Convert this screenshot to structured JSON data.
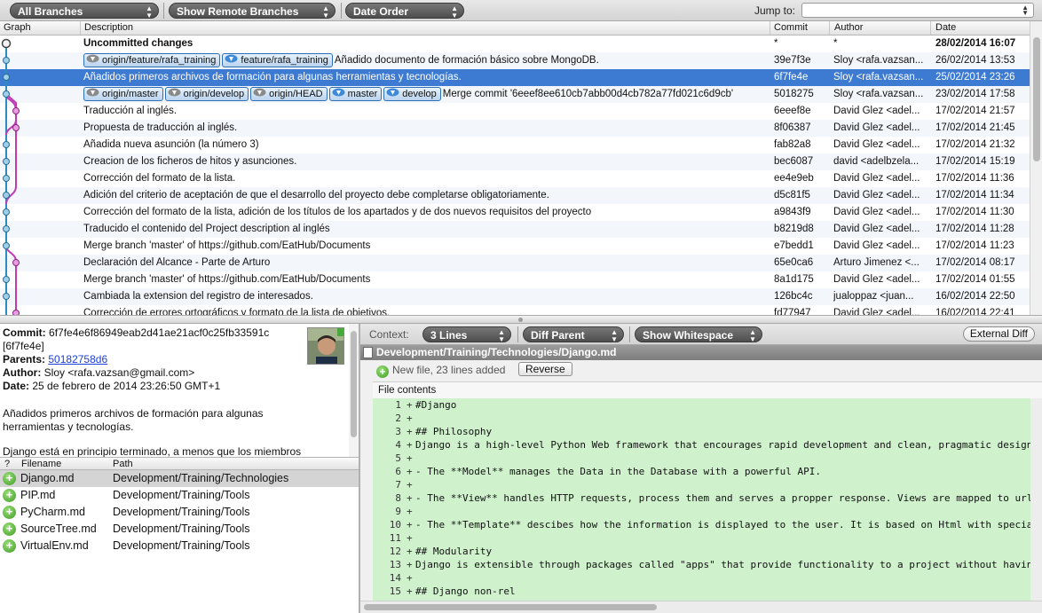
{
  "toolbar": {
    "branches_select": "All Branches",
    "remote_select": "Show Remote Branches",
    "order_select": "Date Order",
    "jump_label": "Jump to:"
  },
  "history": {
    "columns": {
      "graph": "Graph",
      "description": "Description",
      "commit": "Commit",
      "author": "Author",
      "date": "Date"
    },
    "rows": [
      {
        "tags": [],
        "description": "Uncommitted changes",
        "commit": "*",
        "author": "*",
        "date": "28/02/2014 16:07",
        "bold": true
      },
      {
        "tags": [
          {
            "label": "origin/feature/rafa_training",
            "kind": "remote"
          },
          {
            "label": "feature/rafa_training",
            "kind": "local"
          }
        ],
        "description": "Añadido documento de formación básico sobre MongoDB.",
        "commit": "39e7f3e",
        "author": "Sloy <rafa.vazsan...",
        "date": "26/02/2014 13:53"
      },
      {
        "tags": [],
        "description": "Añadidos primeros archivos de formación para algunas herramientas y tecnologías.",
        "commit": "6f7fe4e",
        "author": "Sloy <rafa.vazsan...",
        "date": "25/02/2014 23:26",
        "selected": true
      },
      {
        "tags": [
          {
            "label": "origin/master",
            "kind": "remote"
          },
          {
            "label": "origin/develop",
            "kind": "remote"
          },
          {
            "label": "origin/HEAD",
            "kind": "remote"
          },
          {
            "label": "master",
            "kind": "local"
          },
          {
            "label": "develop",
            "kind": "local"
          }
        ],
        "description": "Merge commit '6eeef8ee610cb7abb00d4cb782a77fd021c6d9cb'",
        "commit": "5018275",
        "author": "Sloy <rafa.vazsan...",
        "date": "23/02/2014 17:58"
      },
      {
        "tags": [],
        "description": "Traducción al inglés.",
        "commit": "6eeef8e",
        "author": "David Glez <adel...",
        "date": "17/02/2014 21:57"
      },
      {
        "tags": [],
        "description": "Propuesta de traducción al inglés.",
        "commit": "8f06387",
        "author": "David Glez <adel...",
        "date": "17/02/2014 21:45"
      },
      {
        "tags": [],
        "description": "Añadida nueva asunción (la número 3)",
        "commit": "fab82a8",
        "author": "David Glez <adel...",
        "date": "17/02/2014 21:32"
      },
      {
        "tags": [],
        "description": "Creacion de los ficheros de hitos y asunciones.",
        "commit": "bec6087",
        "author": "david <adelbzela...",
        "date": "17/02/2014 15:19"
      },
      {
        "tags": [],
        "description": "Corrección del formato de la lista.",
        "commit": "ee4e9eb",
        "author": "David Glez <adel...",
        "date": "17/02/2014 11:36"
      },
      {
        "tags": [],
        "description": "Adición del criterio de aceptación de que el desarrollo del proyecto debe completarse obligatoriamente.",
        "commit": "d5c81f5",
        "author": "David Glez <adel...",
        "date": "17/02/2014 11:34"
      },
      {
        "tags": [],
        "description": "Corrección del formato de la lista, adición de los títulos de los apartados y de dos nuevos requisitos del proyecto",
        "commit": "a9843f9",
        "author": "David Glez <adel...",
        "date": "17/02/2014 11:30"
      },
      {
        "tags": [],
        "description": "Traducido el contenido del Project description al inglés",
        "commit": "b8219d8",
        "author": "David Glez <adel...",
        "date": "17/02/2014 11:28"
      },
      {
        "tags": [],
        "description": "Merge branch 'master' of https://github.com/EatHub/Documents",
        "commit": "e7bedd1",
        "author": "David Glez <adel...",
        "date": "17/02/2014 11:23"
      },
      {
        "tags": [],
        "description": "Declaración del Alcance - Parte de Arturo",
        "commit": "65e0ca6",
        "author": "Arturo Jimenez <...",
        "date": "17/02/2014 08:17"
      },
      {
        "tags": [],
        "description": "Merge branch 'master' of https://github.com/EatHub/Documents",
        "commit": "8a1d175",
        "author": "David Glez <adel...",
        "date": "17/02/2014 01:55"
      },
      {
        "tags": [],
        "description": "Cambiada la extension del registro de interesados.",
        "commit": "126bc4c",
        "author": "jualoppaz <juan...",
        "date": "16/02/2014 22:50"
      },
      {
        "tags": [],
        "description": "Corrección de errores ortográficos y formato de la lista de objetivos.",
        "commit": "fd77947",
        "author": "David Glez <adel...",
        "date": "16/02/2014 22:41"
      }
    ]
  },
  "commit_info": {
    "commit_label": "Commit:",
    "commit_hash_1": "6f7fe4e6f86949eab2d41ae21acf0c25fb33591c",
    "commit_hash_2": "[6f7fe4e]",
    "parents_label": "Parents:",
    "parents_value": "50182758d6",
    "author_label": "Author:",
    "author_value": "Sloy <rafa.vazsan@gmail.com>",
    "date_label": "Date:",
    "date_value": "25 de febrero de 2014 23:26:50 GMT+1",
    "message_1": "Añadidos primeros archivos de formación para algunas",
    "message_2": "herramientas y tecnologías.",
    "message_3": "Django está en principio terminado, a menos que los miembros"
  },
  "files": {
    "columns": {
      "status": "?",
      "filename": "Filename",
      "path": "Path"
    },
    "rows": [
      {
        "name": "Django.md",
        "path": "Development/Training/Technologies",
        "selected": true
      },
      {
        "name": "PIP.md",
        "path": "Development/Training/Tools"
      },
      {
        "name": "PyCharm.md",
        "path": "Development/Training/Tools"
      },
      {
        "name": "SourceTree.md",
        "path": "Development/Training/Tools"
      },
      {
        "name": "VirtualEnv.md",
        "path": "Development/Training/Tools"
      }
    ]
  },
  "diff": {
    "context_label": "Context:",
    "context_select": "3 Lines",
    "parent_select": "Diff Parent",
    "whitespace_select": "Show Whitespace",
    "external_diff": "External Diff",
    "file_path": "Development/Training/Technologies/Django.md",
    "new_file_info": "New file, 23 lines added",
    "reverse_button": "Reverse",
    "file_contents_label": "File contents",
    "lines": [
      {
        "n": "1",
        "text": "#Django"
      },
      {
        "n": "2",
        "text": ""
      },
      {
        "n": "3",
        "text": "## Philosophy"
      },
      {
        "n": "4",
        "text": "Django is a high-level Python Web framework that encourages rapid development and clean, pragmatic design. It tries"
      },
      {
        "n": "5",
        "text": ""
      },
      {
        "n": "6",
        "text": "- The **Model** manages the Data in the Database with a powerful API."
      },
      {
        "n": "7",
        "text": ""
      },
      {
        "n": "8",
        "text": "- The **View** handles HTTP requests, process them and serves a propper response. Views are mapped to urls through"
      },
      {
        "n": "9",
        "text": ""
      },
      {
        "n": "10",
        "text": "- The **Template** descibes how the information is displayed to the user. It is based on Html with special tags, \"{"
      },
      {
        "n": "11",
        "text": ""
      },
      {
        "n": "12",
        "text": "## Modularity"
      },
      {
        "n": "13",
        "text": "Django is extensible through packages called \"apps\" that provide functionality to a project without having to imple"
      },
      {
        "n": "14",
        "text": ""
      },
      {
        "n": "15",
        "text": "## Django non-rel"
      }
    ]
  },
  "colors": {
    "selection": "#3d7ad2",
    "diff_added": "#cff2cd",
    "graph_blue": "#2a8cc0",
    "graph_magenta": "#c13ab5"
  }
}
